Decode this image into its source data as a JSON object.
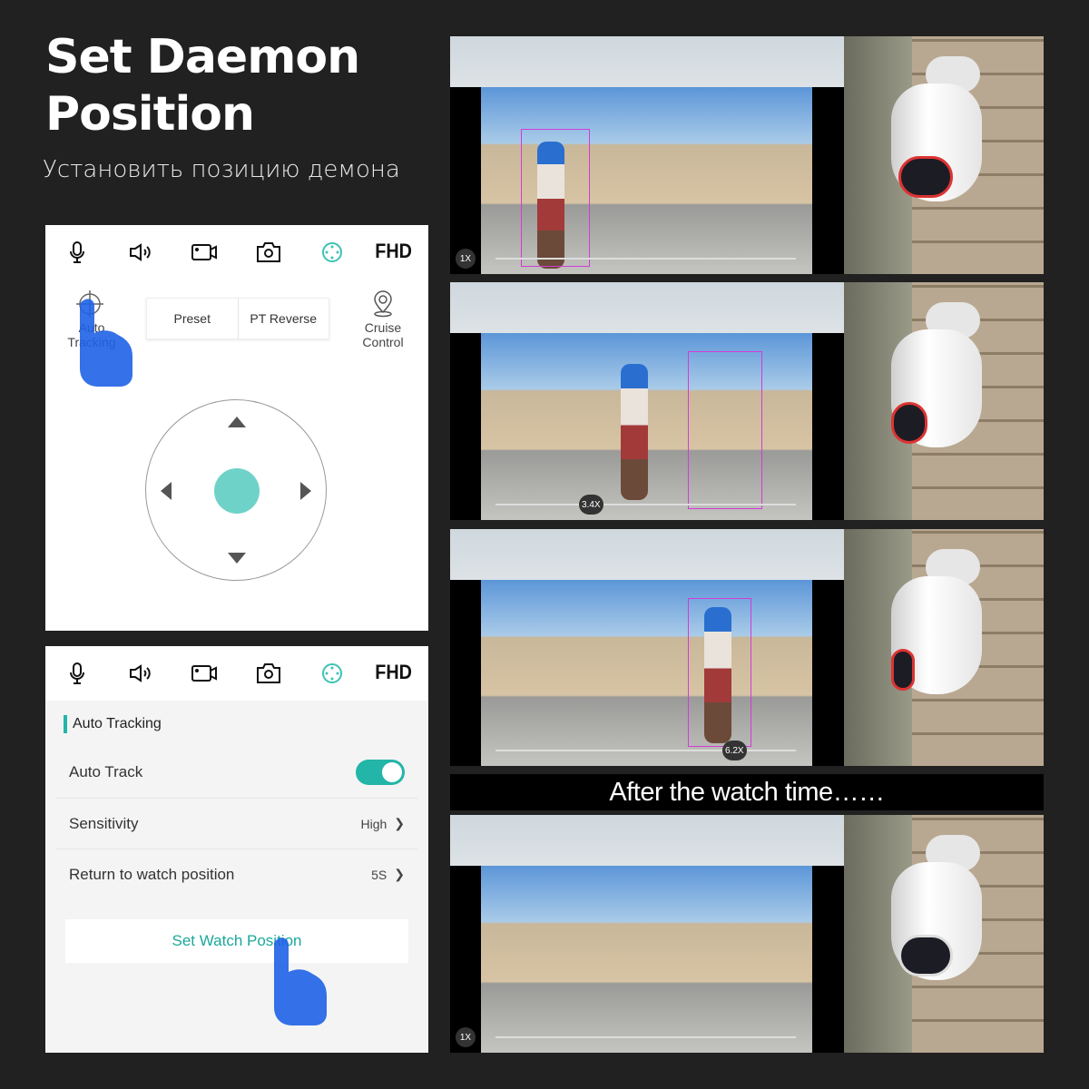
{
  "header": {
    "title_line1": "Set Daemon",
    "title_line2": "Position",
    "subtitle": "Установить позицию демона"
  },
  "panel_ptz": {
    "toolbar": {
      "icons": [
        "microphone-icon",
        "speaker-icon",
        "record-icon",
        "camera-icon",
        "ptz-icon"
      ],
      "quality": "FHD",
      "accent": "#3cc3b4"
    },
    "auto_tracking": "Auto Tracking",
    "preset": "Preset",
    "pt_reverse": "PT Reverse",
    "cruise_control": "Cruise Control",
    "dpad_center_color": "#6fd2c8"
  },
  "panel_settings": {
    "toolbar": {
      "quality": "FHD"
    },
    "section_title": "Auto Tracking",
    "auto_track": {
      "label": "Auto Track",
      "enabled": true
    },
    "sensitivity": {
      "label": "Sensitivity",
      "value": "High"
    },
    "return": {
      "label": "Return to watch position",
      "value": "5S"
    },
    "set_watch_button": "Set Watch Position",
    "accent": "#22b5a8"
  },
  "shots": [
    {
      "zoom": "1X"
    },
    {
      "zoom": "3.4X"
    },
    {
      "zoom": "6.2X"
    },
    {
      "zoom": "1X"
    }
  ],
  "banner": "After the watch time……"
}
